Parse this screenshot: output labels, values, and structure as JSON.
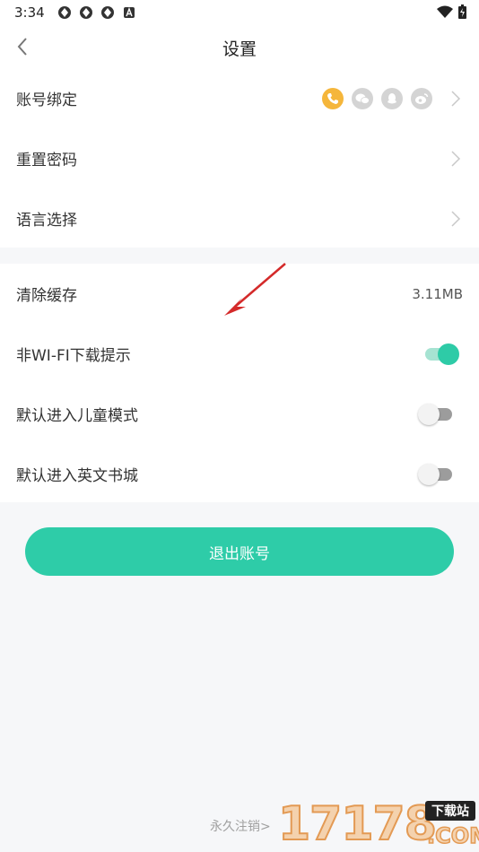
{
  "status_bar": {
    "time": "3:34"
  },
  "header": {
    "title": "设置"
  },
  "section1": {
    "account_binding": "账号绑定",
    "reset_password": "重置密码",
    "language": "语言选择"
  },
  "section2": {
    "clear_cache": "清除缓存",
    "cache_size": "3.11MB",
    "non_wifi_prompt": "非WI-FI下载提示",
    "kids_mode": "默认进入儿童模式",
    "english_store": "默认进入英文书城"
  },
  "toggles": {
    "non_wifi_prompt": true,
    "kids_mode": false,
    "english_store": false
  },
  "social_icons": [
    "phone-icon",
    "wechat-icon",
    "qq-icon",
    "weibo-icon"
  ],
  "colors": {
    "accent": "#2ecca8",
    "phone_bound": "#f5b63b",
    "unbound": "#d4d4d4"
  },
  "logout_label": "退出账号",
  "cancel_account": "永久注销>",
  "watermark": {
    "number": "17178",
    "tag": "下载站",
    "domain": ".COM"
  }
}
